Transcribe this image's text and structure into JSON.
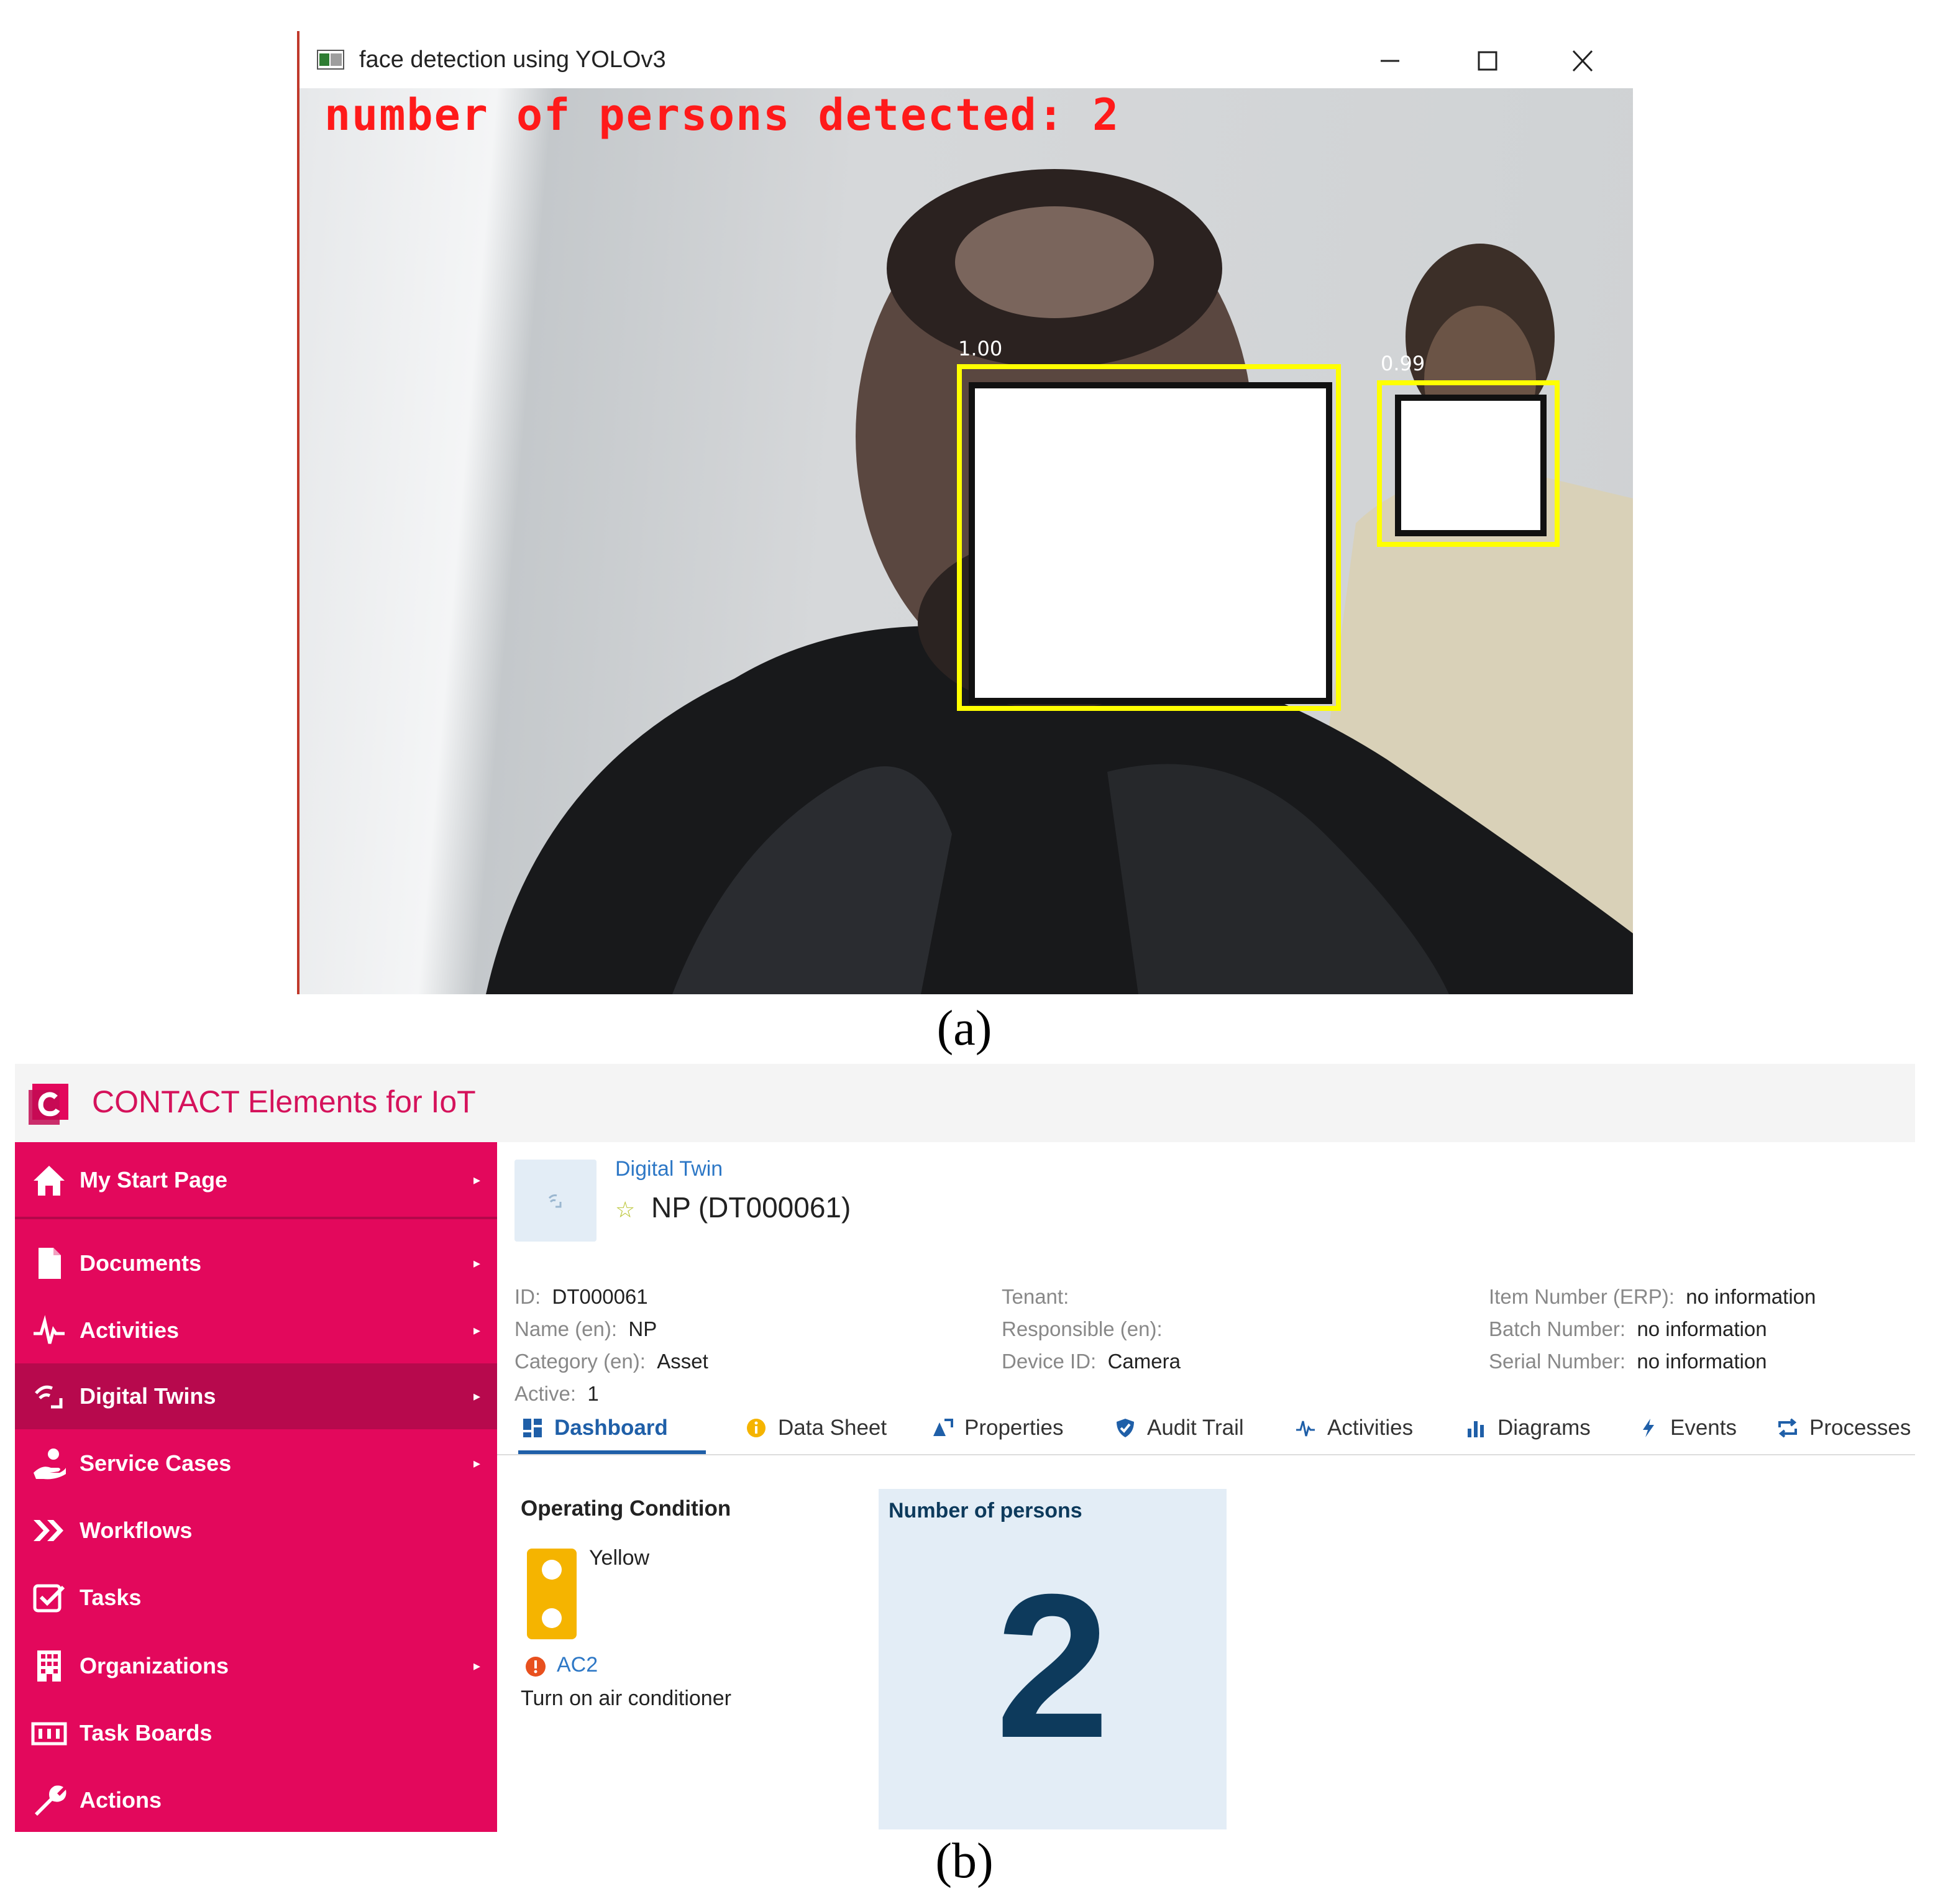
{
  "panel_a": {
    "window_title": "face detection using YOLOv3",
    "overlay_text": "number of persons detected: 2",
    "detections": [
      {
        "confidence": "1.00"
      },
      {
        "confidence": "0.99"
      }
    ],
    "caption": "(a)"
  },
  "panel_b": {
    "app_title": "CONTACT Elements for IoT",
    "brand_color": "#e3085c",
    "sidebar": {
      "items": [
        {
          "label": "My Start Page",
          "icon": "home-icon",
          "caret": "▸"
        },
        {
          "label": "Documents",
          "icon": "document-icon",
          "caret": "▸"
        },
        {
          "label": "Activities",
          "icon": "activity-icon",
          "caret": "▸"
        },
        {
          "label": "Digital Twins",
          "icon": "digital-twin-icon",
          "caret": "▸"
        },
        {
          "label": "Service Cases",
          "icon": "service-hand-icon",
          "caret": "▸"
        },
        {
          "label": "Workflows",
          "icon": "double-chevron-icon"
        },
        {
          "label": "Tasks",
          "icon": "checkbox-icon"
        },
        {
          "label": "Organizations",
          "icon": "building-icon",
          "caret": "▸"
        },
        {
          "label": "Task Boards",
          "icon": "board-icon"
        },
        {
          "label": "Actions",
          "icon": "wrench-icon"
        }
      ]
    },
    "twin": {
      "kind": "Digital Twin",
      "star": "☆",
      "name": "NP (DT000061)"
    },
    "properties": {
      "id_label": "ID:",
      "id_value": "DT000061",
      "name_label": "Name (en):",
      "name_value": "NP",
      "category_label": "Category (en):",
      "category_value": "Asset",
      "active_label": "Active:",
      "active_value": "1",
      "tenant_label": "Tenant:",
      "responsible_label": "Responsible (en):",
      "device_label": "Device ID:",
      "device_value": "Camera",
      "item_label": "Item Number (ERP):",
      "item_value": "no information",
      "batch_label": "Batch Number:",
      "batch_value": "no information",
      "serial_label": "Serial Number:",
      "serial_value": "no information"
    },
    "tabs": [
      {
        "label": "Dashboard",
        "icon": "dashboard-icon",
        "active": true
      },
      {
        "label": "Data Sheet",
        "icon": "info-icon"
      },
      {
        "label": "Properties",
        "icon": "properties-icon"
      },
      {
        "label": "Audit Trail",
        "icon": "shield-check-icon"
      },
      {
        "label": "Activities",
        "icon": "activity-icon"
      },
      {
        "label": "Diagrams",
        "icon": "bar-chart-icon"
      },
      {
        "label": "Events",
        "icon": "lightning-icon"
      },
      {
        "label": "Processes",
        "icon": "cycle-icon"
      }
    ],
    "operating_condition": {
      "title": "Operating Condition",
      "value": "Yellow",
      "alert_code": "AC2",
      "alert_text": "Turn on air conditioner",
      "status_color": "#f5b400"
    },
    "persons_card": {
      "title": "Number of persons",
      "value": "2"
    },
    "caption": "(b)"
  }
}
